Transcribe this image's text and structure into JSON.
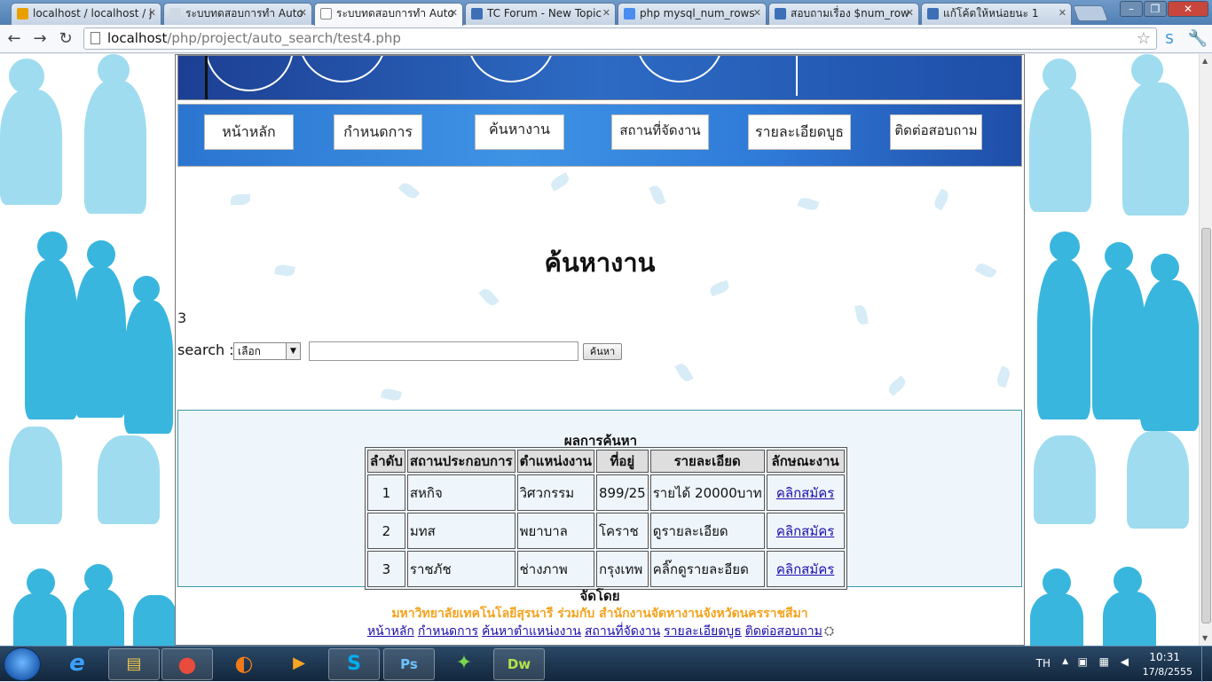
{
  "browser": {
    "tabs": [
      {
        "title": "localhost / localhost / j",
        "fav_color": "#e8a000"
      },
      {
        "title": "ระบบทดสอบการทำ Auto",
        "fav_color": "#cfd8e3"
      },
      {
        "title": "ระบบทดสอบการทำ Auto",
        "fav_color": "#ffffff"
      },
      {
        "title": "TC Forum - New Topic",
        "fav_color": "#3d6fb6"
      },
      {
        "title": "php mysql_num_rows",
        "fav_color": "#4a8cf0"
      },
      {
        "title": "สอบถามเรื่อง $num_row",
        "fav_color": "#3d6fb6"
      },
      {
        "title": "แก้โค้ดให้หน่อยนะ 1",
        "fav_color": "#3d6fb6"
      }
    ],
    "url_host": "localhost",
    "url_path": "/php/project/auto_search/test4.php"
  },
  "menu": {
    "items": [
      "หน้าหลัก",
      "กำหนดการ",
      "ค้นหางาน",
      "สถานที่จัดงาน",
      "รายละเอียดบูธ",
      "ติดต่อสอบถาม"
    ]
  },
  "content": {
    "title": "ค้นหางาน",
    "count": "3",
    "search_label": "search :",
    "select_value": "เลือก",
    "search_button": "ค้นหา"
  },
  "results": {
    "title": "ผลการค้นหา",
    "columns": [
      "ลำดับ",
      "สถานประกอบการ",
      "ตำแหน่งงาน",
      "ที่อยู่",
      "รายละเอียด",
      "ลักษณะงาน"
    ],
    "rows": [
      [
        "1",
        "สหกิจ",
        "วิศวกรรม",
        "899/25",
        "รายได้ 20000บาท",
        "คลิกสมัคร"
      ],
      [
        "2",
        "มทส",
        "พยาบาล",
        "โคราช",
        "ดูรายละเอียด",
        "คลิกสมัคร"
      ],
      [
        "3",
        "ราชภัช",
        "ช่างภาพ",
        "กรุงเทพ",
        "คลิ๊กดูรายละอียด",
        "คลิกสมัคร"
      ]
    ]
  },
  "footer": {
    "by": "จัดโดย",
    "org": "มหาวิทยาลัยเทคโนโลยีสุรนารี ร่วมกับ สำนักงานจัดหางานจังหวัดนครราชสีมา",
    "links": [
      "หน้าหลัก",
      "กำหนดการ",
      "ค้นหาตำแหน่งงาน",
      "สถานที่จัดงาน",
      "รายละเอียดบูธ",
      "ติดต่อสอบถาม"
    ]
  },
  "taskbar": {
    "lang": "TH",
    "time": "10:31",
    "date": "17/8/2555",
    "apps": [
      {
        "name": "internet-explorer",
        "glyph": "e",
        "color": "#3aa0ff"
      },
      {
        "name": "file-explorer",
        "glyph": "▤",
        "color": "#f2c84b"
      },
      {
        "name": "chrome",
        "glyph": "●",
        "color": "#e94b3c"
      },
      {
        "name": "firefox",
        "glyph": "◐",
        "color": "#f07a1a"
      },
      {
        "name": "media-player",
        "glyph": "▶",
        "color": "#f5a623"
      },
      {
        "name": "skype",
        "glyph": "S",
        "color": "#00aff0"
      },
      {
        "name": "photoshop",
        "glyph": "Ps",
        "color": "#6fc3ff"
      },
      {
        "name": "network",
        "glyph": "✦",
        "color": "#7bd34b"
      },
      {
        "name": "dreamweaver",
        "glyph": "Dw",
        "color": "#b5e34a"
      }
    ]
  },
  "colors": {
    "link": "#1a0dab",
    "org_text": "#f4a21c",
    "menu_blue": "#2b75d0"
  }
}
